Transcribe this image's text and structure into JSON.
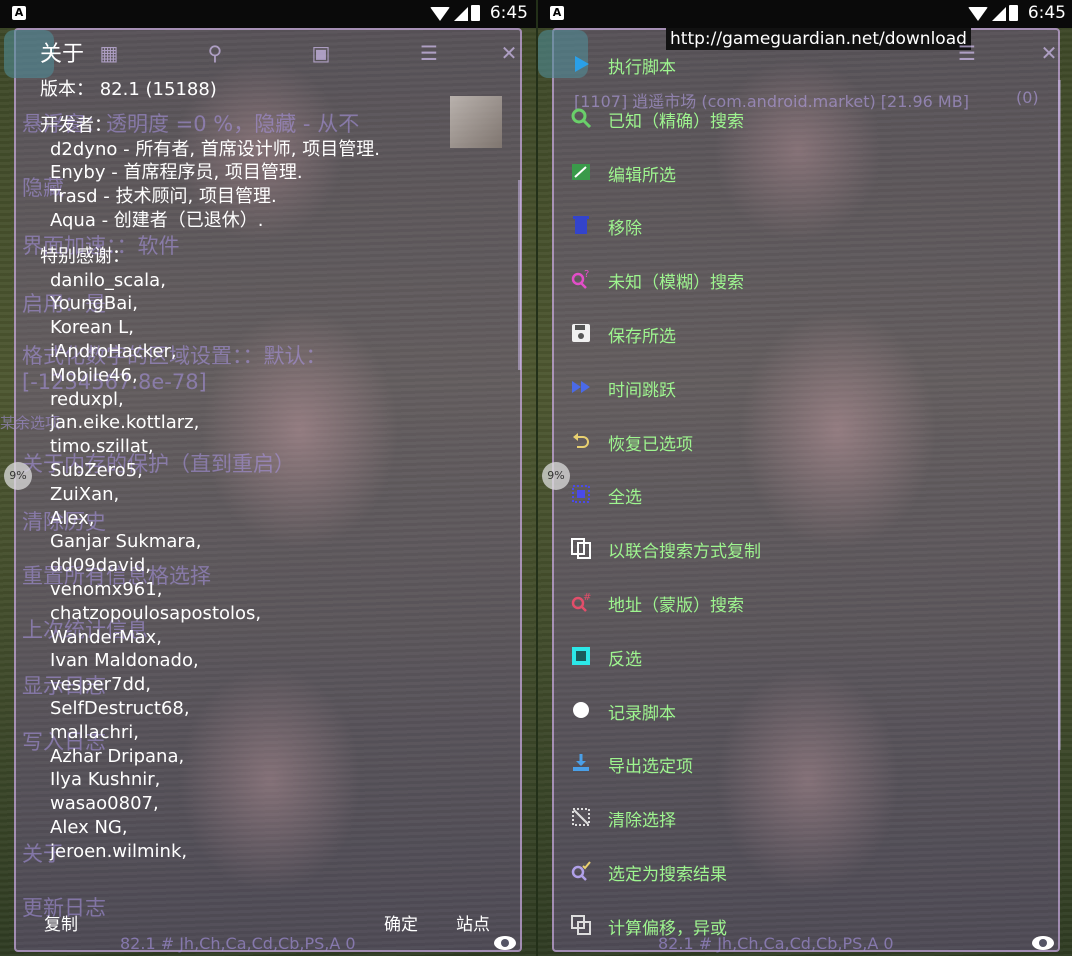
{
  "status_bar": {
    "time": "6:45",
    "app_icon": "A"
  },
  "left": {
    "title": "关于",
    "version_line": "版本： 82.1 (15188)",
    "developers_heading": "开发者：",
    "developers": [
      "d2dyno - 所有者, 首席设计师, 项目管理.",
      "Enyby - 首席程序员, 项目管理.",
      "Trasd - 技术顾问, 项目管理.",
      "Aqua - 创建者（已退休）."
    ],
    "thanks_heading": "特别感谢：",
    "thanks": [
      "danilo_scala,",
      "YoungBai,",
      "Korean L,",
      "iAndroHacker,",
      "Mobile46,",
      "reduxpl,",
      "jan.eike.kottlarz,",
      "timo.szillat,",
      "SubZero5,",
      "ZuiXan,",
      "Alex,",
      "Ganjar Sukmara,",
      "dd09david,",
      "venomx961,",
      "chatzopoulosapostolos,",
      "WanderMax,",
      "Ivan Maldonado,",
      "vesper7dd,",
      "SelfDestruct68,",
      "mallachri,",
      "Azhar Dripana,",
      "Ilya Kushnir,",
      "wasao0807,",
      "Alex NG,",
      "jeroen.wilmink,"
    ],
    "background_settings": [
      "悬浮窗：透明度 =0 %，隐藏 - 从不",
      "隐藏",
      "界面加速：：软件",
      "启用：是",
      "格式化数字的区域设置：：默认：",
      "[-1234567.8e-78]",
      "关于内存的保护（直到重启）",
      "清除历史",
      "重置所有信息格选择",
      "上次统计信息",
      "显示日志",
      "写入日志",
      "关于",
      "更新日志"
    ],
    "bg_small": "某余选项",
    "buttons": {
      "copy": "复制",
      "ok": "确定",
      "site": "站点"
    },
    "footer": "82.1 # Jh,Ch,Ca,Cd,Cb,PS,A 0",
    "progress": "9%"
  },
  "right": {
    "url": "http://gameguardian.net/download",
    "process": "[1107] 逍遥市场 (com.android.market) [21.96 MB]",
    "process_count": "(0)",
    "menu": [
      {
        "label": "执行脚本",
        "icon": "play-icon"
      },
      {
        "label": "已知（精确）搜索",
        "icon": "search-icon"
      },
      {
        "label": "编辑所选",
        "icon": "edit-icon"
      },
      {
        "label": "移除",
        "icon": "trash-icon"
      },
      {
        "label": "未知（模糊）搜索",
        "icon": "fuzzy-search-icon"
      },
      {
        "label": "保存所选",
        "icon": "save-icon"
      },
      {
        "label": "时间跳跃",
        "icon": "fast-forward-icon"
      },
      {
        "label": "恢复已选项",
        "icon": "undo-icon"
      },
      {
        "label": "全选",
        "icon": "select-all-icon"
      },
      {
        "label": "以联合搜索方式复制",
        "icon": "copy-icon"
      },
      {
        "label": "地址（蒙版）搜索",
        "icon": "address-search-icon"
      },
      {
        "label": "反选",
        "icon": "invert-selection-icon"
      },
      {
        "label": "记录脚本",
        "icon": "record-icon"
      },
      {
        "label": "导出选定项",
        "icon": "export-icon"
      },
      {
        "label": "清除选择",
        "icon": "clear-selection-icon"
      },
      {
        "label": "选定为搜索结果",
        "icon": "search-check-icon"
      },
      {
        "label": "计算偏移，异或",
        "icon": "offset-icon"
      }
    ],
    "footer": "82.1 # Jh,Ch,Ca,Cd,Cb,PS,A 0",
    "progress": "9%"
  },
  "colors": {
    "menu_text": "#9ef58f",
    "accent_purple": "#b08ee0"
  }
}
